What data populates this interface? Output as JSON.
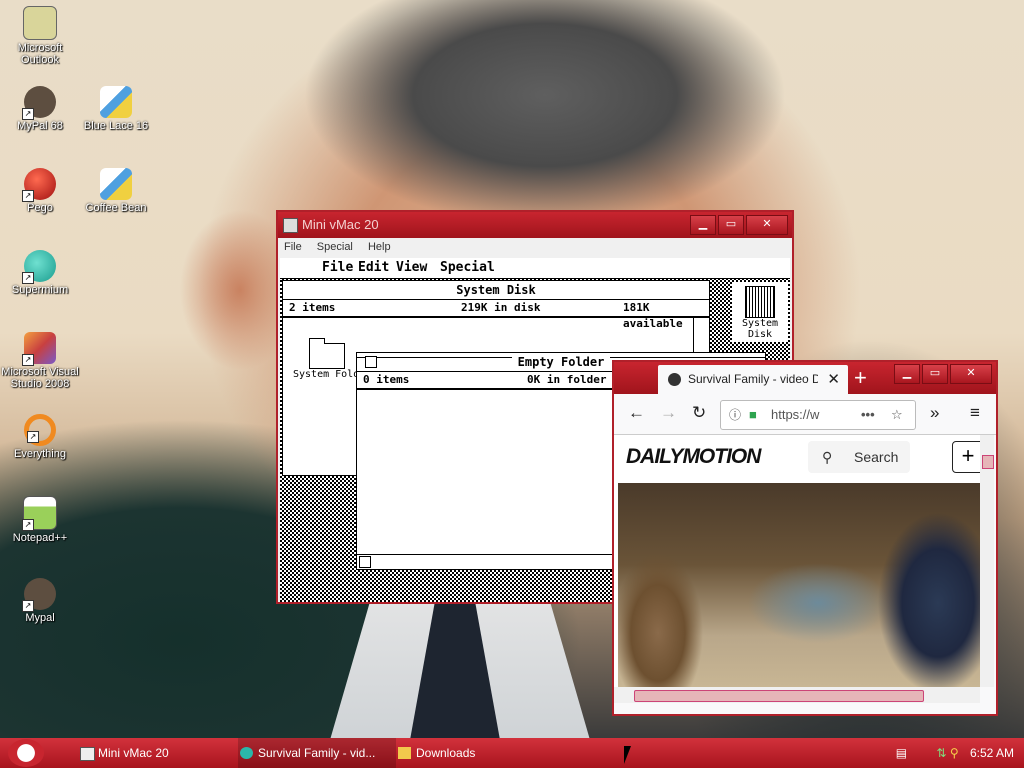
{
  "desktop": {
    "icons": [
      {
        "label": "Microsoft Outlook",
        "icon": "outlook-icon",
        "color": "#c8c48c"
      },
      {
        "label": "MyPal 68",
        "icon": "raccoon-icon",
        "color": "#6b5a4a"
      },
      {
        "label": "Blue Lace 16",
        "icon": "paint-icon",
        "color": "#e8eef8"
      },
      {
        "label": "Pego",
        "icon": "red-ball-icon",
        "color": "#c8281c"
      },
      {
        "label": "Coffee Bean",
        "icon": "paint-icon",
        "color": "#e8eef8"
      },
      {
        "label": "Supermium",
        "icon": "supermium-icon",
        "color": "#2ab7a9"
      },
      {
        "label": "Microsoft Visual Studio 2008",
        "icon": "visual-studio-icon",
        "color": "#e07a3a"
      },
      {
        "label": "Everything",
        "icon": "everything-icon",
        "color": "#f08a20"
      },
      {
        "label": "Notepad++",
        "icon": "notepad-plus-icon",
        "color": "#8ac24a"
      },
      {
        "label": "Mypal",
        "icon": "raccoon-icon",
        "color": "#6b5a4a"
      }
    ]
  },
  "vmac": {
    "title": "Mini vMac 20",
    "menu": [
      "File",
      "Special",
      "Help"
    ],
    "mac_menu": [
      "File",
      "Edit",
      "View",
      "Special"
    ],
    "system_disk": {
      "title": "System Disk",
      "items": "2 items",
      "in_disk": "219K in disk",
      "available": "181K available",
      "folder_label": "System Folder"
    },
    "empty_folder": {
      "title": "Empty Folder",
      "items": "0 items",
      "in_folder": "0K in folder"
    },
    "desktop_disk_label": "System Disk"
  },
  "firefox": {
    "tab_label": "Survival Family - video Daily",
    "url": "https://w",
    "site_logo": "DAILYMOTION",
    "search_label": "Search"
  },
  "taskbar": {
    "items": [
      {
        "label": "Mini vMac 20",
        "icon": "app-window-icon"
      },
      {
        "label": "Survival Family - vid...",
        "icon": "supermium-icon"
      },
      {
        "label": "Downloads",
        "icon": "folder-icon"
      }
    ],
    "clock": "6:52 AM"
  },
  "colors": {
    "accent": "#b0202a",
    "taskbar": "#c8252f"
  }
}
